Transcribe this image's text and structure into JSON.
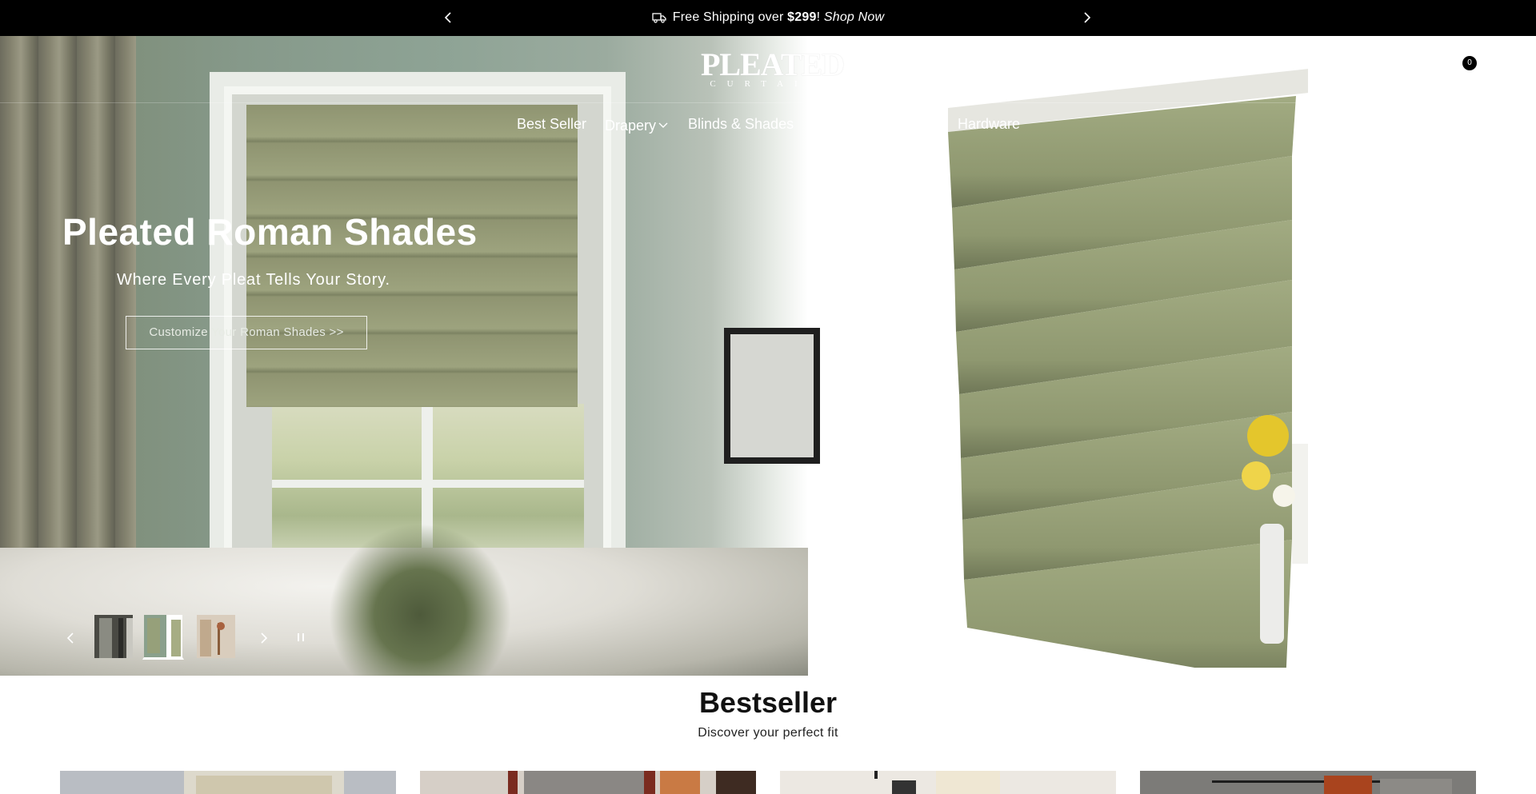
{
  "announcement": {
    "prefix": "Free Shipping over ",
    "amount": "$299",
    "suffix": "! ",
    "link": "Shop Now",
    "icon": "truck-icon"
  },
  "header": {
    "logo_main": "PLEATED",
    "logo_sub": "CURTAIN",
    "cart_count": "0"
  },
  "nav": {
    "items": [
      "Best Seller",
      "Drapery",
      "Blinds & Shades",
      "Hardware"
    ]
  },
  "hero": {
    "title": "Pleated Roman Shades",
    "subtitle": "Where Every Pleat Tells Your Story.",
    "cta": "Customize Your Roman Shades >>"
  },
  "slider": {
    "active_index": 1,
    "thumb_count": 3
  },
  "bestseller": {
    "title": "Bestseller",
    "subtitle": "Discover your perfect fit"
  },
  "colors": {
    "announcement_bg": "#000000",
    "hero_green": "#86998a",
    "shade_green": "#8f9471"
  }
}
